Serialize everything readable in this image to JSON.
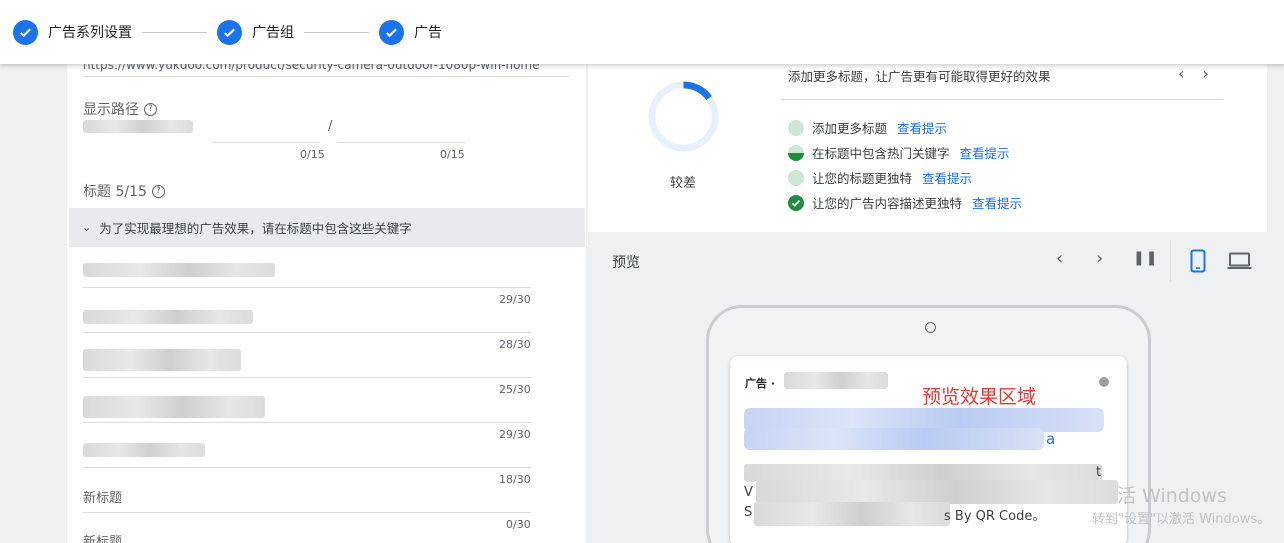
{
  "stepper": {
    "steps": [
      {
        "label": "广告系列设置"
      },
      {
        "label": "广告组"
      },
      {
        "label": "广告"
      }
    ]
  },
  "editor": {
    "final_url": "https://www.yukdoo.com/product/security-camera-outdoor-1080p-wifi-home",
    "display_path": {
      "label": "显示路径",
      "separator": "/",
      "path1_count": "0/15",
      "path2_count": "0/15"
    },
    "headlines": {
      "label": "标题 5/15",
      "keyword_banner": "为了实现最理想的广告效果，请在标题中包含这些关键字",
      "counts": [
        "29/30",
        "28/30",
        "25/30",
        "29/30",
        "18/30",
        "0/30"
      ],
      "new_headline_label": "新标题"
    }
  },
  "ad_strength": {
    "value": 0.15,
    "grade": "较差",
    "top_tip": "添加更多标题，让广告更有可能取得更好的效果",
    "prev_icon": "chevron-left-icon",
    "next_icon": "chevron-right-icon",
    "tips": [
      {
        "text": "添加更多标题",
        "status": "todo",
        "link": "查看提示"
      },
      {
        "text": "在标题中包含热门关键字",
        "status": "partial",
        "link": "查看提示"
      },
      {
        "text": "让您的标题更独特",
        "status": "todo",
        "link": "查看提示"
      },
      {
        "text": "让您的广告内容描述更独特",
        "status": "done",
        "link": "查看提示"
      }
    ],
    "colors": {
      "ring": "#1a73e8",
      "ring_track": "#e8f0fe",
      "done": "#1e8e3e",
      "todo": "#cde6d5"
    }
  },
  "preview": {
    "title": "预览",
    "ad_label": "广告 ·",
    "overlay_text": "预览效果区域",
    "headline_tail": "a",
    "description_end": "t",
    "description_line2_start": "V",
    "description_line3_start": "S",
    "description_line3_tail": "s By QR Code。",
    "colors": {
      "accent": "#1a73e8",
      "overlay": "#e53935"
    }
  },
  "watermark": {
    "line1": "活 Windows",
    "line2": "转到\"设置\"以激活 Windows。"
  }
}
